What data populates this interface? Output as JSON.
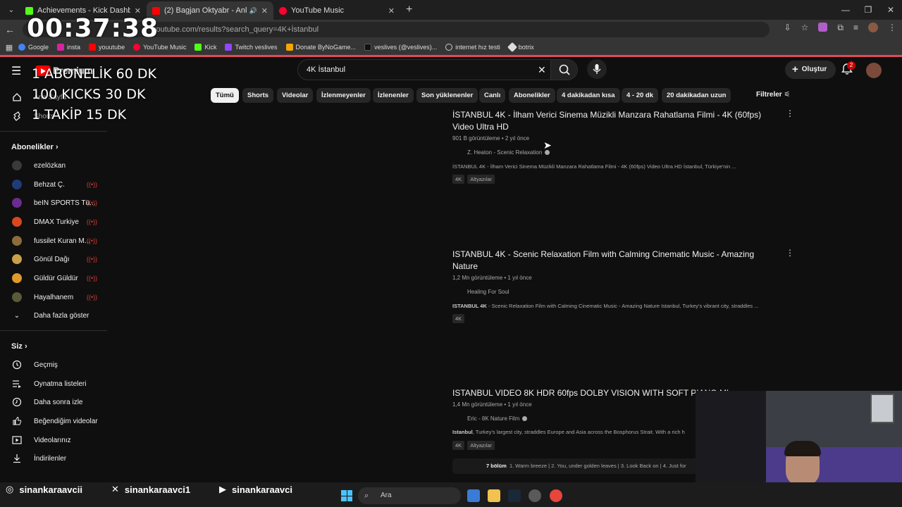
{
  "browser": {
    "tabs": [
      {
        "title": "Achievements - Kick Dashboard",
        "favicon_color": "#53fc18"
      },
      {
        "title": "(2) Bagjan Oktyabr - Anlatam",
        "favicon_color": "#ff0000"
      },
      {
        "title": "YouTube Music",
        "favicon_color": "#ff0033"
      }
    ],
    "url": "youtube.com/results?search_query=4K+İstanbul",
    "bookmarks": [
      "Google",
      "insta",
      "youutube",
      "YouTube Music",
      "Kick",
      "Twitch veslives",
      "Donate ByNoGame...",
      "veslives (@veslives)...",
      "internet hız testi",
      "botrix"
    ]
  },
  "overlay": {
    "timer": "00:37:38",
    "goals": [
      "1 ABONELİK 60 DK",
      "100 KICKS 30 DK",
      "1 TAKİP 15 DK"
    ]
  },
  "masthead": {
    "logo_text": "Premium",
    "search_value": "4K İstanbul",
    "create_label": "Oluştur",
    "notification_count": "2"
  },
  "sidebar": {
    "top": [
      {
        "label": "Ana Sayfa",
        "icon": "home-icon"
      },
      {
        "label": "Shorts",
        "icon": "shorts-icon"
      }
    ],
    "subscriptions_title": "Abonelikler",
    "subscriptions": [
      {
        "label": "ezelözkan",
        "color": "#3a3a3a",
        "live": false
      },
      {
        "label": "Behzat Ç.",
        "color": "#1f3b7a",
        "live": true
      },
      {
        "label": "beIN SPORTS Tü...",
        "color": "#6b2c8f",
        "live": true
      },
      {
        "label": "DMAX Turkiye",
        "color": "#d9481c",
        "live": true
      },
      {
        "label": "fussilet Kuran M...",
        "color": "#8a6d3b",
        "live": true
      },
      {
        "label": "Gönül Dağı",
        "color": "#c8a04a",
        "live": true
      },
      {
        "label": "Güldür Güldür",
        "color": "#e09a2b",
        "live": true
      },
      {
        "label": "Hayalhanem",
        "color": "#5a5a3a",
        "live": true
      }
    ],
    "show_more": "Daha fazla göster",
    "you_title": "Siz",
    "you_items": [
      {
        "label": "Geçmiş",
        "icon": "history-icon"
      },
      {
        "label": "Oynatma listeleri",
        "icon": "playlists-icon"
      },
      {
        "label": "Daha sonra izle",
        "icon": "watch-later-icon"
      },
      {
        "label": "Beğendiğim videolar",
        "icon": "like-icon"
      },
      {
        "label": "Videolarınız",
        "icon": "your-videos-icon"
      },
      {
        "label": "İndirilenler",
        "icon": "downloads-icon"
      }
    ]
  },
  "chips": [
    "Tümü",
    "Shorts",
    "Videolar",
    "İzlenmeyenler",
    "İzlenenler",
    "Son yüklenenler",
    "Canlı",
    "Abonelikler",
    "4 dakikadan kısa",
    "4 - 20 dk",
    "20 dakikadan uzun"
  ],
  "filters_label": "Filtreler",
  "results": [
    {
      "title": "İSTANBUL 4K - İlham Verici Sinema Müzikli Manzara Rahatlama Filmi - 4K (60fps) Video Ultra HD",
      "meta": "901 B görüntüleme • 2 yıl önce",
      "channel": "Z. Heaton - Scenic Relaxation",
      "desc": "İSTANBUL 4K - İlham Verici Sinema Müzikli Manzara Rahatlama Filmi - 4K (60fps) Video Ultra HD İstanbul, Türkiye'nin ...",
      "tags": [
        "4K",
        "Altyazılar"
      ]
    },
    {
      "title": "ISTANBUL 4K - Scenic Relaxation Film with Calming Cinematic Music - Amazing Nature",
      "meta": "1,2 Mn görüntüleme • 1 yıl önce",
      "channel": "Healing For Soul",
      "desc_bold": "ISTANBUL 4K",
      "desc": " - Scenic Relaxation Film with Calming Cinematic Music - Amazing Nature Istanbul, Turkey's vibrant city, straddles ...",
      "tags": [
        "4K"
      ]
    },
    {
      "title": "ISTANBUL VIDEO 8K HDR 60fps DOLBY VISION WITH SOFT PIANO MUSIC",
      "meta": "1,4 Mn görüntüleme • 1 yıl önce",
      "channel": "Eric - 8K Nature Film",
      "desc_bold": "Istanbul",
      "desc": ", Turkey's largest city, straddles Europe and Asia across the Bosphorus Strait. With a rich h",
      "tags": [
        "4K",
        "Altyazılar"
      ],
      "chapters_count": "7 bölüm",
      "chapters": "1. Warm breeze | 2. You, under golden leaves | 3. Look Back on | 4. Just for"
    }
  ],
  "socials": [
    "sinankaraavcii",
    "sinankaraavci1",
    "sinankaraavci"
  ],
  "taskbar": {
    "search_placeholder": "Ara"
  }
}
